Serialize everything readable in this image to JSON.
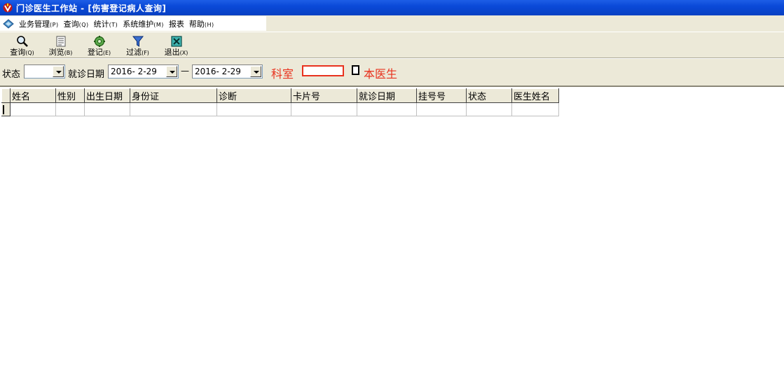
{
  "window": {
    "title": "门诊医生工作站 - [伤害登记病人查询]"
  },
  "menu": [
    {
      "label": "业务管理",
      "hot": "(P)"
    },
    {
      "label": "查询",
      "hot": "(Q)"
    },
    {
      "label": "统计",
      "hot": "(T)"
    },
    {
      "label": "系统维护",
      "hot": "(M)"
    },
    {
      "label": "报表",
      "hot": ""
    },
    {
      "label": "帮助",
      "hot": "(H)"
    }
  ],
  "toolbar": [
    {
      "label": "查询",
      "hot": "(Q)",
      "icon": "magnifier-icon"
    },
    {
      "label": "浏览",
      "hot": "(B)",
      "icon": "browse-list-icon"
    },
    {
      "label": "登记",
      "hot": "(E)",
      "icon": "register-gear-icon"
    },
    {
      "label": "过滤",
      "hot": "(F)",
      "icon": "funnel-icon"
    },
    {
      "label": "退出",
      "hot": "(X)",
      "icon": "exit-icon"
    }
  ],
  "filters": {
    "status_label": "状态",
    "status_value": "",
    "date_label": "就诊日期",
    "date_from": "2016- 2-29",
    "date_sep": "—",
    "date_to": "2016- 2-29",
    "dept_label": "科室",
    "own_doctor_label": "本医生",
    "own_doctor_checked": false
  },
  "grid": {
    "columns": [
      "姓名",
      "性别",
      "出生日期",
      "身份证",
      "诊断",
      "卡片号",
      "就诊日期",
      "挂号号",
      "状态",
      "医生姓名"
    ],
    "rows": [
      [
        "",
        "",
        "",
        "",
        "",
        "",
        "",
        "",
        "",
        ""
      ]
    ]
  },
  "colors": {
    "title_bar": "#0a49d8",
    "face": "#ece9d8",
    "accent_red": "#e8321e"
  }
}
